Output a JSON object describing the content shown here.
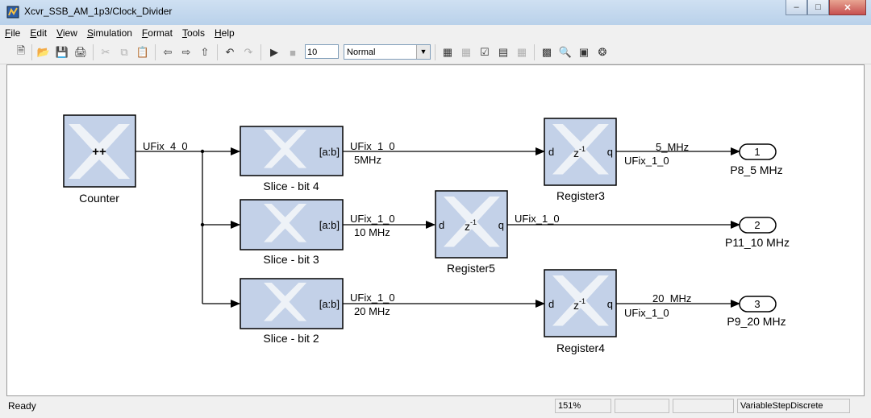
{
  "window": {
    "title": "Xcvr_SSB_AM_1p3/Clock_Divider"
  },
  "menu": [
    "File",
    "Edit",
    "View",
    "Simulation",
    "Format",
    "Tools",
    "Help"
  ],
  "toolbar": {
    "stop_time": "10",
    "sim_mode": "Normal",
    "icons": [
      "new-model-icon",
      "open-icon",
      "save-icon",
      "print-icon",
      "cut-icon",
      "copy-icon",
      "paste-icon",
      "back-icon",
      "forward-icon",
      "up-level-icon",
      "undo-icon",
      "redo-icon",
      "start-simulation-icon",
      "stop-simulation-icon",
      "build-icon",
      "library-browser-icon",
      "model-explorer-icon",
      "debug-icon"
    ]
  },
  "blocks": {
    "counter": {
      "label": "Counter",
      "glyph": "++"
    },
    "slice4": {
      "label": "Slice - bit 4",
      "port": "[a:b]"
    },
    "slice3": {
      "label": "Slice - bit 3",
      "port": "[a:b]"
    },
    "slice2": {
      "label": "Slice - bit 2",
      "port": "[a:b]"
    },
    "register3": {
      "label": "Register3",
      "d": "d",
      "q": "q"
    },
    "register5": {
      "label": "Register5",
      "d": "d",
      "q": "q"
    },
    "register4": {
      "label": "Register4",
      "d": "d",
      "q": "q"
    },
    "out1": {
      "num": "1",
      "label": "P8_5 MHz"
    },
    "out2": {
      "num": "2",
      "label": "P11_10 MHz"
    },
    "out3": {
      "num": "3",
      "label": "P9_20 MHz"
    }
  },
  "signals": {
    "counter_out": "UFix_4_0",
    "s4_type": "UFix_1_0",
    "s4_name": "5MHz",
    "s3_type": "UFix_1_0",
    "s3_name": "10 MHz",
    "s2_type": "UFix_1_0",
    "s2_name": "20 MHz",
    "r3_name": "5_MHz",
    "r3_type": "UFix_1_0",
    "r5_type": "UFix_1_0",
    "r4_name": "20_MHz",
    "r4_type": "UFix_1_0"
  },
  "status": {
    "ready": "Ready",
    "zoom": "151%",
    "solver": "VariableStepDiscrete"
  },
  "colors": {
    "block_fill": "#c3d1e8",
    "block_border": "#000000",
    "canvas": "#ffffff"
  }
}
